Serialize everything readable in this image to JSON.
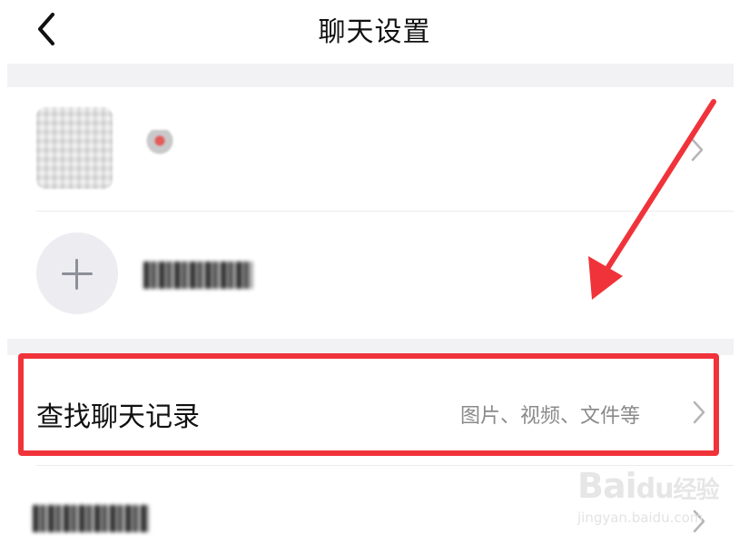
{
  "header": {
    "title": "聊天设置",
    "back_icon": "chevron-left-icon"
  },
  "members": {
    "add_icon": "plus-icon",
    "chevron_icon": "chevron-right-icon"
  },
  "search_history": {
    "label": "查找聊天记录",
    "hint": "图片、视频、文件等",
    "chevron_icon": "chevron-right-icon"
  },
  "annotation": {
    "highlight_color": "#f0333a",
    "arrow_color": "#f0333a"
  },
  "watermark": {
    "logo": "Bai",
    "logo2": "du",
    "logo3": "经验",
    "url": "jingyan.baidu.com"
  }
}
